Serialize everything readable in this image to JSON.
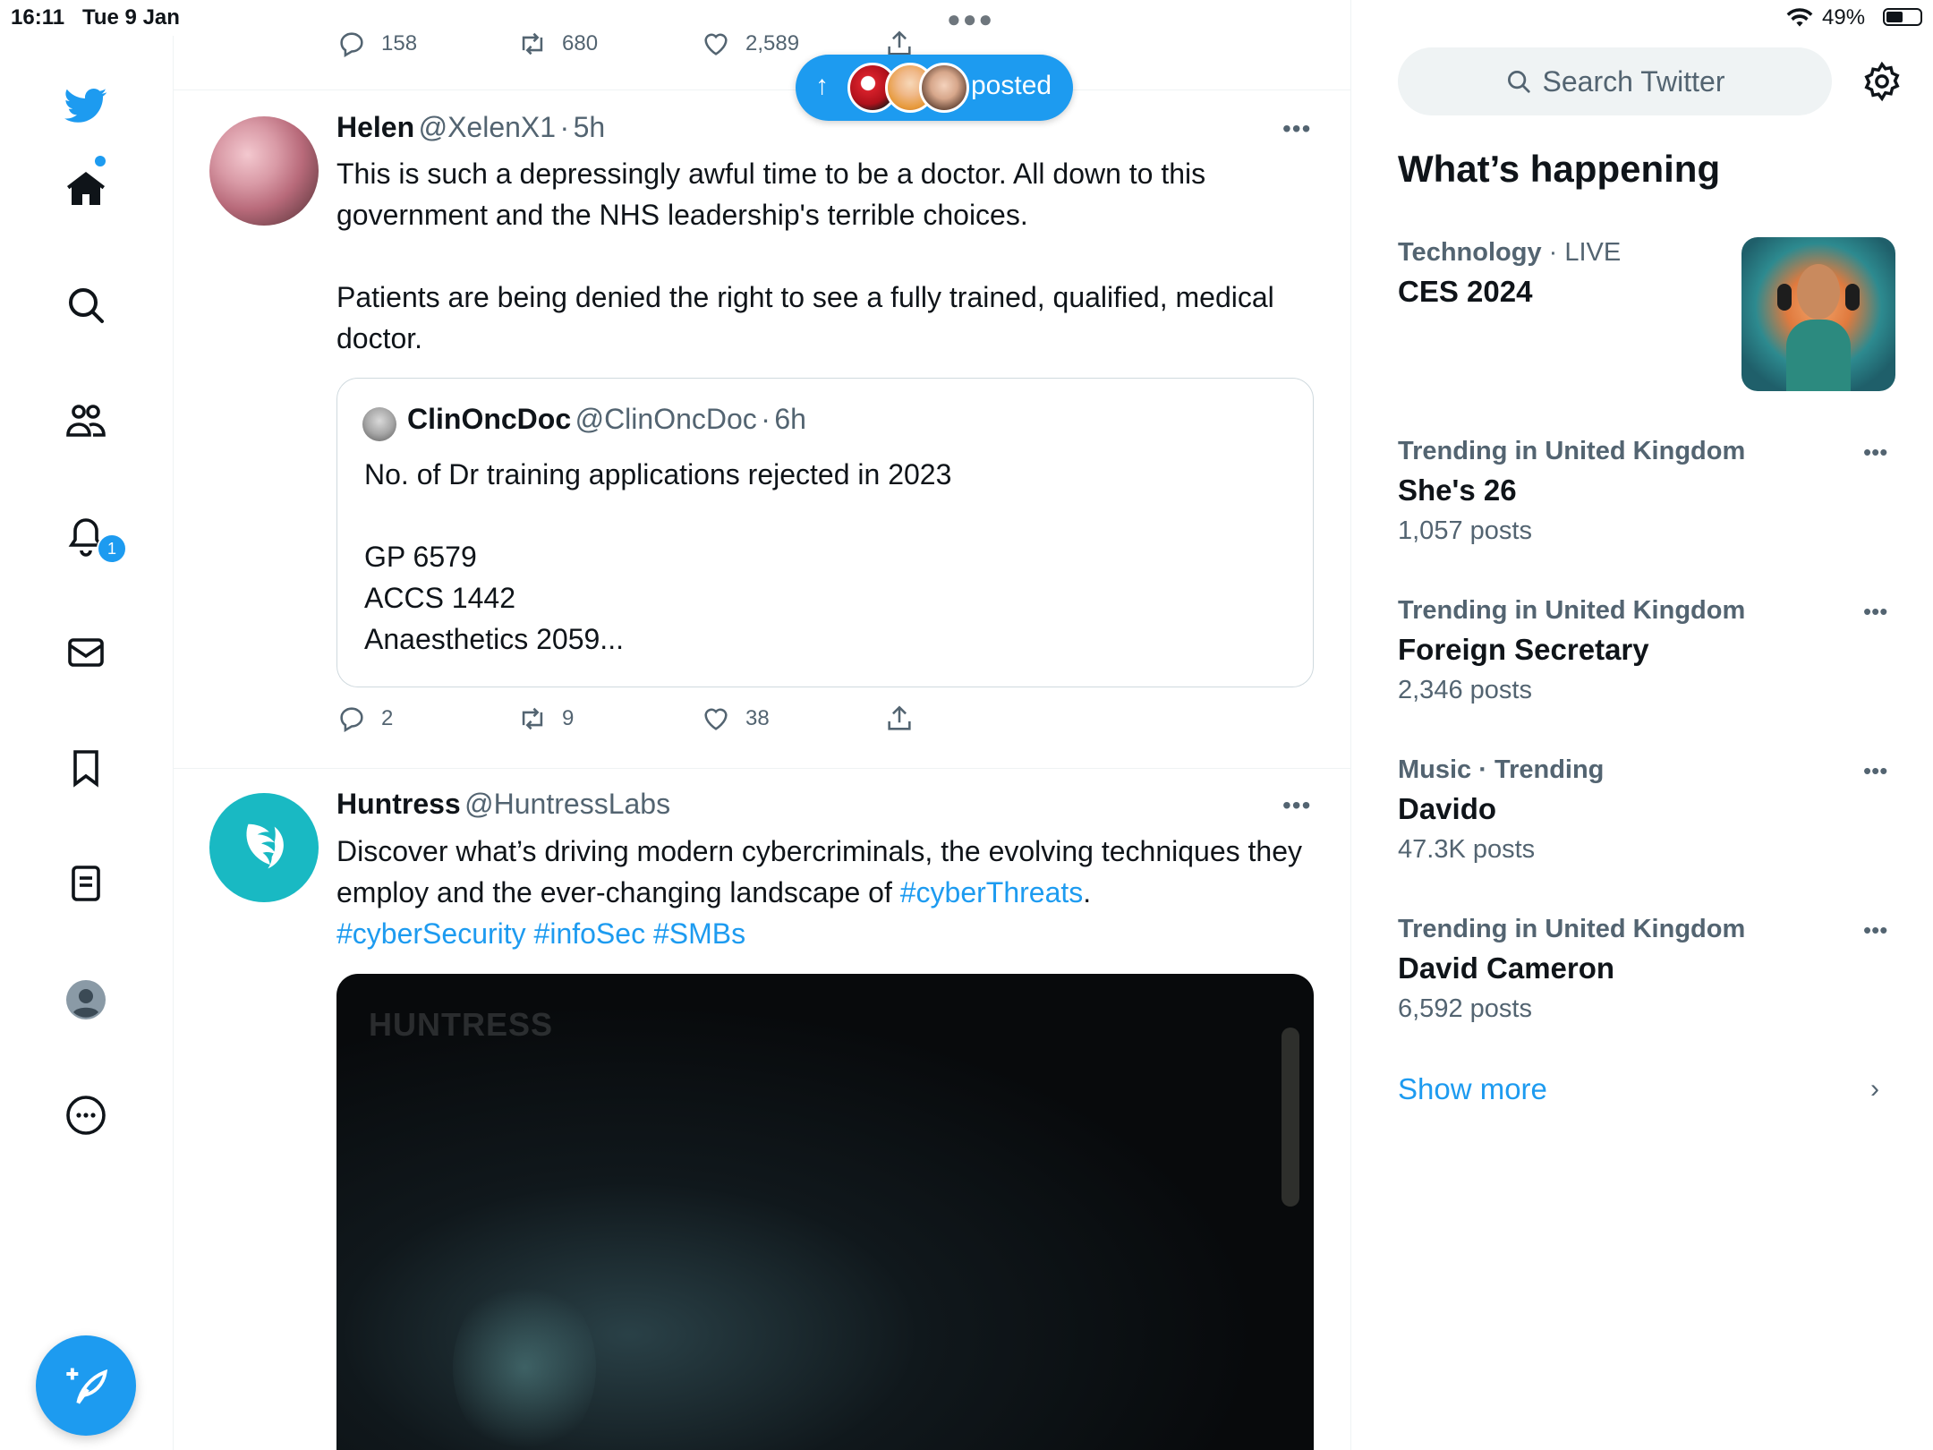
{
  "status_bar": {
    "time": "16:11",
    "date": "Tue 9 Jan",
    "battery": "49%",
    "battery_level": 0.49
  },
  "nav": {
    "notification_count": "1",
    "items": [
      "home",
      "explore",
      "communities",
      "notifications",
      "messages",
      "bookmarks",
      "lists",
      "profile",
      "more"
    ]
  },
  "new_posts_pill": {
    "label": "posted"
  },
  "prev_tweet": {
    "replies": "158",
    "retweets": "680",
    "likes": "2,589"
  },
  "tweets": [
    {
      "name": "Helen",
      "handle": "@XelenX1",
      "time": "5h",
      "text": "This is such a depressingly awful time to be a doctor. All down to this government and the NHS leadership's terrible choices.\n\nPatients are being denied the right to see a fully trained, qualified, medical doctor.",
      "quote": {
        "name": "ClinOncDoc",
        "handle": "@ClinOncDoc",
        "time": "6h",
        "text": "No. of Dr training applications rejected in 2023\n\nGP 6579\nACCS 1442\nAnaesthetics 2059..."
      },
      "replies": "2",
      "retweets": "9",
      "likes": "38"
    },
    {
      "name": "Huntress",
      "handle": "@HuntressLabs",
      "text_before": "Discover what’s driving modern cybercriminals, the evolving techniques they employ and the ever-changing landscape of ",
      "hashtag1": "#cyberThreats",
      "text_after": ".",
      "hashtags": "#cyberSecurity #infoSec #SMBs",
      "video_watermark": "HUNTRESS"
    }
  ],
  "sidebar": {
    "search_placeholder": "Search Twitter",
    "title": "What’s happening",
    "trends": [
      {
        "category": "Technology",
        "context": "LIVE",
        "title": "CES 2024"
      },
      {
        "context": "Trending in United Kingdom",
        "title": "She's 26",
        "count": "1,057 posts"
      },
      {
        "context": "Trending in United Kingdom",
        "title": "Foreign Secretary",
        "count": "2,346 posts"
      },
      {
        "context": "Music · Trending",
        "title": "Davido",
        "count": "47.3K posts"
      },
      {
        "context": "Trending in United Kingdom",
        "title": "David Cameron",
        "count": "6,592 posts"
      }
    ],
    "show_more": "Show more"
  },
  "colors": {
    "accent": "#1d9bf0",
    "text": "#0f1419",
    "secondary": "#536471"
  }
}
